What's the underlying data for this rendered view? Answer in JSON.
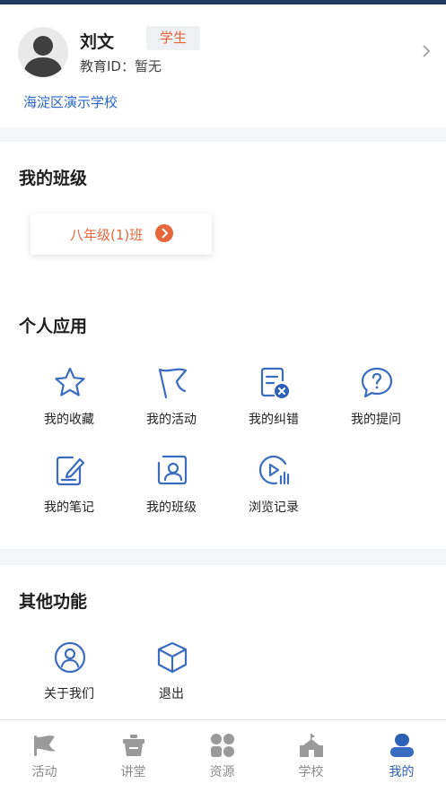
{
  "profile": {
    "name": "刘文",
    "role_badge": "学生",
    "edu_id": "教育ID：暂无",
    "school": "海淀区演示学校"
  },
  "my_class": {
    "title": "我的班级",
    "class_label": "八年级(1)班"
  },
  "personal_apps": {
    "title": "个人应用",
    "items": [
      {
        "label": "我的收藏",
        "icon": "star-icon"
      },
      {
        "label": "我的活动",
        "icon": "flag-icon"
      },
      {
        "label": "我的纠错",
        "icon": "document-error-icon"
      },
      {
        "label": "我的提问",
        "icon": "question-bubble-icon"
      },
      {
        "label": "我的笔记",
        "icon": "notebook-pen-icon"
      },
      {
        "label": "我的班级",
        "icon": "class-person-icon"
      },
      {
        "label": "浏览记录",
        "icon": "play-history-icon"
      }
    ]
  },
  "other_functions": {
    "title": "其他功能",
    "items": [
      {
        "label": "关于我们",
        "icon": "user-circle-icon"
      },
      {
        "label": "退出",
        "icon": "cube-icon"
      }
    ]
  },
  "tabbar": {
    "items": [
      {
        "label": "活动",
        "icon": "flag-icon"
      },
      {
        "label": "讲堂",
        "icon": "podium-icon"
      },
      {
        "label": "资源",
        "icon": "grid-icon"
      },
      {
        "label": "学校",
        "icon": "school-icon"
      },
      {
        "label": "我的",
        "icon": "user-icon"
      }
    ],
    "active": "我的"
  },
  "colors": {
    "accent_blue": "#2e5fb7",
    "icon_blue": "#3a6cc0",
    "orange": "#e8663a",
    "tab_gray": "#8a8a8a",
    "separator": "#f5f6f8"
  }
}
